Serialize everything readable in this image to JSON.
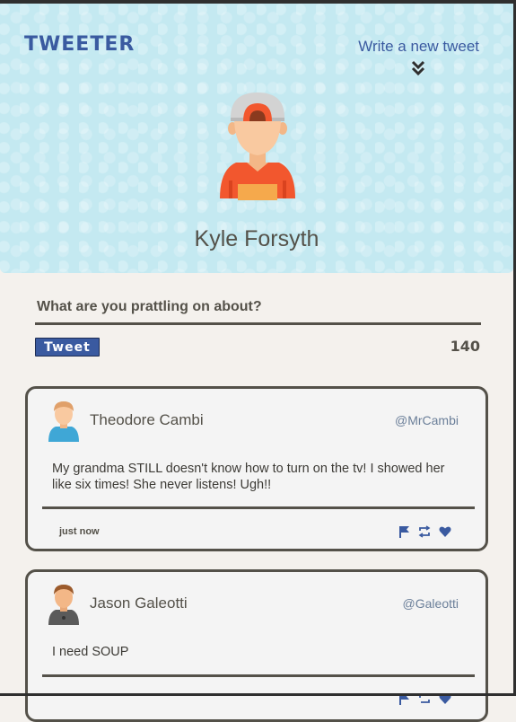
{
  "app": {
    "brand": "Tweeter",
    "compose_link": "Write a new tweet"
  },
  "profile": {
    "name": "Kyle Forsyth"
  },
  "composer": {
    "label": "What are you prattling on about?",
    "button_label": "Tweet",
    "counter": "140"
  },
  "tweets": [
    {
      "name": "Theodore Cambi",
      "handle": "@MrCambi",
      "body": "My grandma STILL doesn't know how to turn on the tv! I showed her like six times! She never listens! Ugh!!",
      "time": "just now"
    },
    {
      "name": "Jason Galeotti",
      "handle": "@Galeotti",
      "body": "I need SOUP"
    }
  ],
  "icons": {
    "compose": "double-chevron-down-icon",
    "actions": [
      "flag-icon",
      "retweet-icon",
      "heart-icon"
    ]
  },
  "colors": {
    "accent": "#3a5aa0",
    "hero_bg": "#c4e9f1",
    "text": "#545149",
    "page_bg": "#f4f1ed"
  }
}
